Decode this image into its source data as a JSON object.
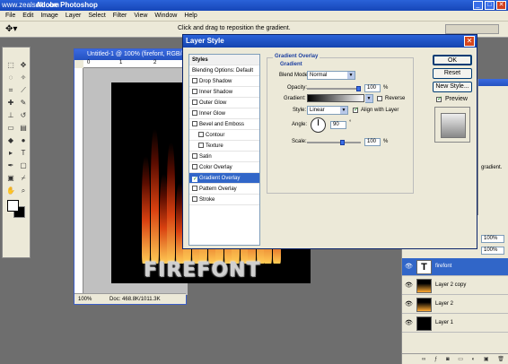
{
  "app": {
    "watermark": "www.zealsoft.com",
    "title": "Adobe Photoshop"
  },
  "menu": [
    "File",
    "Edit",
    "Image",
    "Layer",
    "Select",
    "Filter",
    "View",
    "Window",
    "Help"
  ],
  "options_bar": {
    "hint": "Click and drag to reposition the gradient."
  },
  "document": {
    "title": "Untitled-1 @ 100% (firefont, RGB/8)",
    "ruler_labels": [
      "0",
      "1",
      "2"
    ],
    "zoom": "100%",
    "doc_size": "Doc: 468.8K/1011.3K",
    "canvas_text": "FIREFONT"
  },
  "dialog": {
    "title": "Layer Style",
    "styles_header": "Styles",
    "style_items": [
      {
        "label": "Blending Options: Default",
        "checkbox": false,
        "checked": false,
        "indent": false,
        "selected": false
      },
      {
        "label": "Drop Shadow",
        "checkbox": true,
        "checked": false,
        "indent": false,
        "selected": false
      },
      {
        "label": "Inner Shadow",
        "checkbox": true,
        "checked": false,
        "indent": false,
        "selected": false
      },
      {
        "label": "Outer Glow",
        "checkbox": true,
        "checked": false,
        "indent": false,
        "selected": false
      },
      {
        "label": "Inner Glow",
        "checkbox": true,
        "checked": false,
        "indent": false,
        "selected": false
      },
      {
        "label": "Bevel and Emboss",
        "checkbox": true,
        "checked": false,
        "indent": false,
        "selected": false
      },
      {
        "label": "Contour",
        "checkbox": true,
        "checked": false,
        "indent": true,
        "selected": false
      },
      {
        "label": "Texture",
        "checkbox": true,
        "checked": false,
        "indent": true,
        "selected": false
      },
      {
        "label": "Satin",
        "checkbox": true,
        "checked": false,
        "indent": false,
        "selected": false
      },
      {
        "label": "Color Overlay",
        "checkbox": true,
        "checked": false,
        "indent": false,
        "selected": false
      },
      {
        "label": "Gradient Overlay",
        "checkbox": true,
        "checked": true,
        "indent": false,
        "selected": true
      },
      {
        "label": "Pattern Overlay",
        "checkbox": true,
        "checked": false,
        "indent": false,
        "selected": false
      },
      {
        "label": "Stroke",
        "checkbox": true,
        "checked": false,
        "indent": false,
        "selected": false
      }
    ],
    "section_title": "Gradient Overlay",
    "group_title": "Gradient",
    "blend_mode_label": "Blend Mode:",
    "blend_mode_value": "Normal",
    "opacity_label": "Opacity:",
    "opacity_value": "100",
    "opacity_level": 1.0,
    "percent": "%",
    "gradient_label": "Gradient:",
    "reverse_label": "Reverse",
    "reverse_checked": false,
    "style_label": "Style:",
    "style_value": "Linear",
    "align_label": "Align with Layer",
    "align_checked": true,
    "angle_label": "Angle:",
    "angle_value": "90",
    "degree": "°",
    "scale_label": "Scale:",
    "scale_value": "100",
    "scale_level": 0.67,
    "ok": "OK",
    "reset": "Reset",
    "new_style": "New Style...",
    "preview_label": "Preview",
    "preview_checked": true
  },
  "right_panel": {
    "text": "gradient."
  },
  "layers": {
    "opacity": "100%",
    "fill": "100%",
    "items": [
      {
        "name": "firefont",
        "thumb": "T",
        "selected": true
      },
      {
        "name": "Layer 2 copy",
        "thumb": "fire",
        "selected": false
      },
      {
        "name": "Layer 2",
        "thumb": "fire",
        "selected": false
      },
      {
        "name": "Layer 1",
        "thumb": "black",
        "selected": false
      }
    ]
  }
}
